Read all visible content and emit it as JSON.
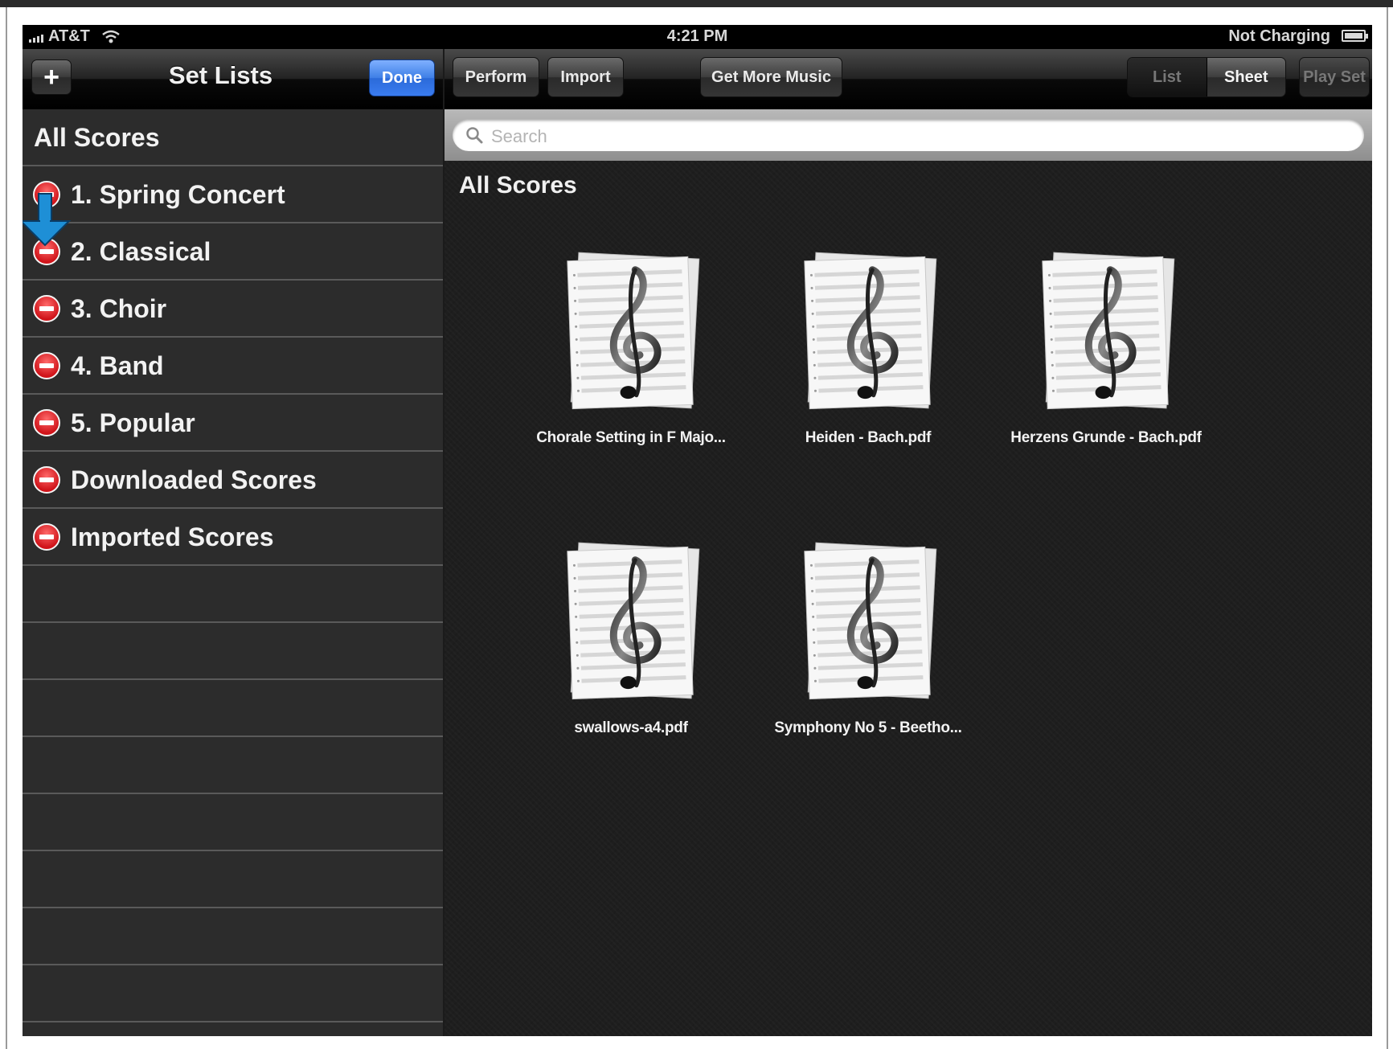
{
  "status_bar": {
    "carrier": "AT&T",
    "time": "4:21 PM",
    "battery_status": "Not Charging"
  },
  "left_toolbar": {
    "add_label": "+",
    "title": "Set Lists",
    "done_label": "Done"
  },
  "set_lists": {
    "header": "All Scores",
    "items": [
      {
        "label": "1. Spring Concert"
      },
      {
        "label": "2. Classical"
      },
      {
        "label": "3. Choir"
      },
      {
        "label": "4. Band"
      },
      {
        "label": "5. Popular"
      },
      {
        "label": "Downloaded Scores"
      },
      {
        "label": "Imported Scores"
      }
    ]
  },
  "right_toolbar": {
    "perform_label": "Perform",
    "import_label": "Import",
    "get_more_label": "Get More Music",
    "view_list_label": "List",
    "view_sheet_label": "Sheet",
    "selected_view": "Sheet",
    "play_set_label": "Play Set"
  },
  "search": {
    "placeholder": "Search"
  },
  "main": {
    "title": "All Scores",
    "scores": [
      {
        "name": "Chorale Setting in F Majo..."
      },
      {
        "name": "Heiden - Bach.pdf"
      },
      {
        "name": "Herzens Grunde - Bach.pdf"
      },
      {
        "name": "swallows-a4.pdf"
      },
      {
        "name": "Symphony No 5 - Beetho..."
      }
    ]
  },
  "colors": {
    "accent_blue": "#3e7fe6",
    "delete_red": "#d0141a",
    "arrow_blue": "#1e8fd6"
  },
  "icons": [
    "signal-icon",
    "wifi-icon",
    "battery-icon",
    "delete-icon",
    "search-icon",
    "treble-clef-icon",
    "down-arrow-icon"
  ]
}
